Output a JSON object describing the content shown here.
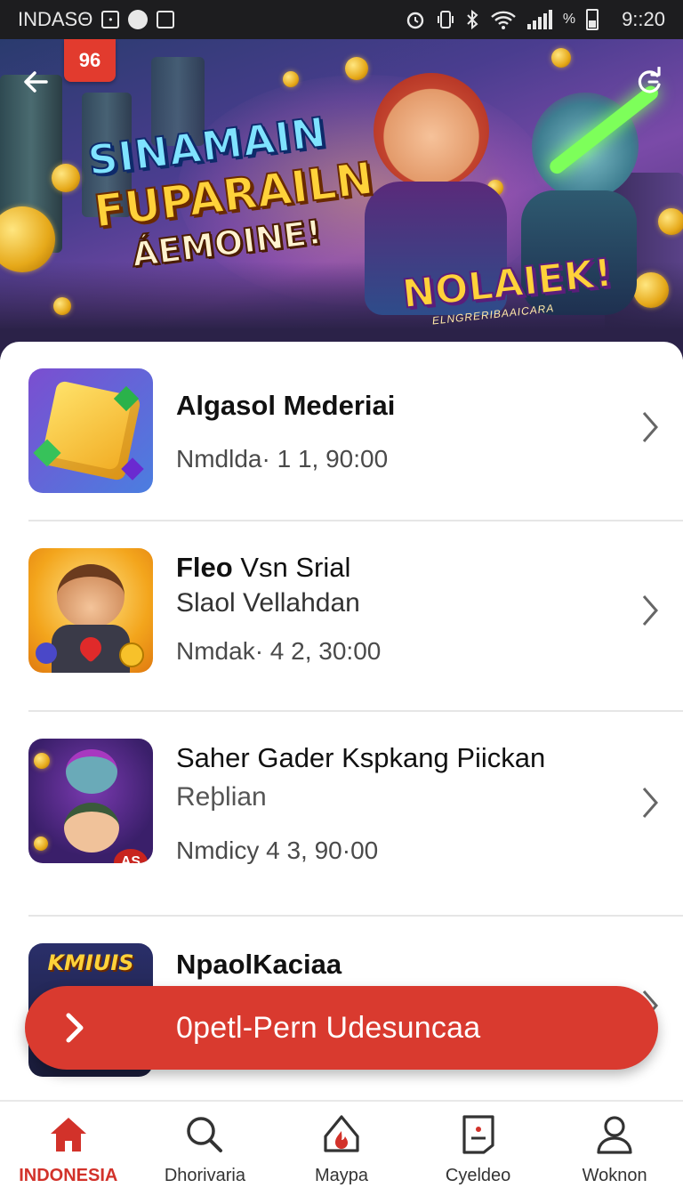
{
  "status_bar": {
    "carrier": "INDASΘ",
    "battery_pct_label": "%",
    "time": "9::20"
  },
  "banner": {
    "tag": "96",
    "title_line1": "SINAMAIN",
    "title_line2": "FUPARAILN",
    "title_line3": "ÁEMOINE!",
    "badge_main": "NOLAIEK!",
    "badge_sub": "ELNGRERIBAAICARA"
  },
  "list": {
    "items": [
      {
        "title_bold": "Algasol Mederiai",
        "title_rest": "",
        "subtitle": "",
        "meta": "Nmdlda· 1 1, 90:00"
      },
      {
        "title_bold": "Fleo",
        "title_rest": " Vsn Srial",
        "subtitle": "Slaol Vellahdan",
        "meta": "Nmdak· 4 2, 30:00"
      },
      {
        "title_bold": "Saher Gader Kspkang Piickan",
        "title_rest": "",
        "subtitle": "Reþlian",
        "meta": "Nmdicy 4 3, 90·00"
      },
      {
        "title_bold": "NpaolKaciaa",
        "title_rest": "",
        "subtitle": "",
        "meta": "",
        "thumb_text": "KMIUIS"
      }
    ],
    "thumb3_badge": "AS"
  },
  "cta": {
    "label": "0petl-Pern Udesuncaa"
  },
  "bottom_nav": {
    "items": [
      {
        "label": "INDONESIA",
        "icon": "home-icon",
        "active": true
      },
      {
        "label": "Dhorivaria",
        "icon": "search-icon",
        "active": false
      },
      {
        "label": "Maypa",
        "icon": "fire-icon",
        "active": false
      },
      {
        "label": "Cyeldeo",
        "icon": "document-icon",
        "active": false
      },
      {
        "label": "Woknon",
        "icon": "profile-icon",
        "active": false
      }
    ]
  },
  "colors": {
    "accent": "#d93a2f",
    "nav_active": "#d2322a",
    "status_bar_bg": "#1d1d1f"
  }
}
